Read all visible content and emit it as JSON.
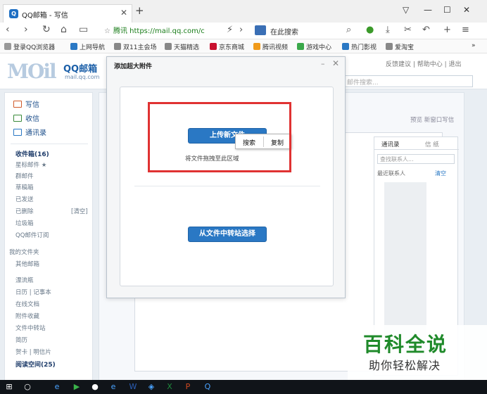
{
  "browser": {
    "tab_title": "QQ邮箱 - 写信",
    "tab_icon": "Q",
    "url": "腾讯 https://mail.qq.com/c",
    "search_placeholder": "在此搜索",
    "bookmarks": [
      "登录QQ浏览器",
      "上网导航",
      "双11主会场",
      "天猫精选",
      "京东商城",
      "腾讯视频",
      "游戏中心",
      "热门影视",
      "爱淘宝"
    ]
  },
  "mail": {
    "logo_text": "QQ邮箱",
    "logo_sub": "mail.qq.com",
    "top_links": "反馈建议 | 帮助中心 | 退出",
    "search_placeholder": "邮件搜索...",
    "side_big": [
      "写信",
      "收信",
      "通讯录"
    ],
    "folders": [
      "收件箱(16)",
      "星标邮件 ★",
      "群邮件",
      "草稿箱",
      "已发送",
      "已删除",
      "垃圾箱",
      "QQ邮件订阅",
      "我的文件夹",
      "其他邮箱",
      "漂流瓶",
      "日历 | 记事本",
      "在线文档",
      "附件收藏",
      "文件中转站",
      "简历",
      "贺卡 | 明信片",
      "阅读空间(25)"
    ],
    "clear_label": "[清空]",
    "content_links": "预览  新窗口写信",
    "contacts_tabs": [
      "通讯录",
      "信 纸"
    ],
    "contacts_search": "查找联系人...",
    "contacts_row": [
      "最近联系人",
      "清空"
    ]
  },
  "modal": {
    "title": "添加超大附件",
    "upload_button": "上传新文件",
    "drop_hint": "将文件拖拽至此区域",
    "transfer_button": "从文件中转站选择",
    "context_menu": [
      "搜索",
      "复制"
    ]
  },
  "watermark": {
    "main": "百科全说",
    "sub": "助你轻松解决"
  },
  "colors": {
    "accent": "#2a78c4",
    "highlight": "#e03232",
    "watermark_green": "#1f8a2a"
  }
}
